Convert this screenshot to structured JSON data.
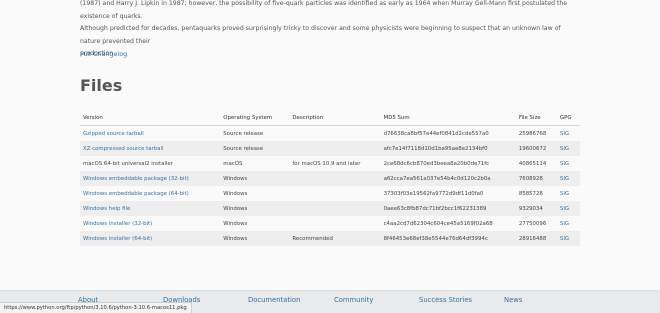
{
  "intro": {
    "line1": "(1987) and Harry J. Lipkin in 1987; however, the possibility of five-quark particles was identified as early as 1964 when Murray Gell-Mann first postulated the existence of quarks.",
    "line2": "Although predicted for decades, pentaquarks proved surprisingly tricky to discover and some physicists were beginning to suspect that an unknown law of nature prevented their",
    "line3": "production."
  },
  "full_changelog_label": "Full Changelog",
  "files": {
    "heading": "Files",
    "columns": [
      "Version",
      "Operating System",
      "Description",
      "MD5 Sum",
      "File Size",
      "GPG"
    ],
    "rows": [
      {
        "version": "Gzipped source tarball",
        "os": "Source release",
        "description": "",
        "md5": "d76638ca8bf57e44ef0841d2cde557a0",
        "size": "25986768",
        "gpg": "SIG",
        "link": true
      },
      {
        "version": "XZ compressed source tarball",
        "os": "Source release",
        "description": "",
        "md5": "afc7e14f7118d10d1ba95ae8e2134bf0",
        "size": "19600672",
        "gpg": "SIG",
        "link": true
      },
      {
        "version": "macOS 64-bit universal2 installer",
        "os": "macOS",
        "description": "for macOS 10.9 and later",
        "md5": "2ce68dc6cb870ed3beea8a20b0de71fc",
        "size": "40865114",
        "gpg": "SIG",
        "link": false
      },
      {
        "version": "Windows embeddable package (32-bit)",
        "os": "Windows",
        "description": "",
        "md5": "a62cca7ea561a037e54b4c0d120c2b0a",
        "size": "7608928",
        "gpg": "SIG",
        "link": true
      },
      {
        "version": "Windows embeddable package (64-bit)",
        "os": "Windows",
        "description": "",
        "md5": "37303f03e19562fa9772d9df11d0fa0",
        "size": "8585728",
        "gpg": "SIG",
        "link": true
      },
      {
        "version": "Windows help file",
        "os": "Windows",
        "description": "",
        "md5": "0aee63c8fb87dc71bf2bcc1f62231389",
        "size": "9329034",
        "gpg": "SIG",
        "link": true
      },
      {
        "version": "Windows installer (32-bit)",
        "os": "Windows",
        "description": "",
        "md5": "c4aa2cd7d62304c604ce45a5169f02a68",
        "size": "27750096",
        "gpg": "SIG",
        "link": true
      },
      {
        "version": "Windows installer (64-bit)",
        "os": "Windows",
        "description": "Recommended",
        "md5": "8f46453e68ef38e5544e76d64df3994c",
        "size": "28916488",
        "gpg": "SIG",
        "link": true
      }
    ]
  },
  "footer": {
    "nav": [
      "About",
      "Downloads",
      "Documentation",
      "Community",
      "Success Stories",
      "News"
    ]
  },
  "status_url": "https://www.python.org/ftp/python/3.10.6/python-3.10.6-macos11.pkg"
}
